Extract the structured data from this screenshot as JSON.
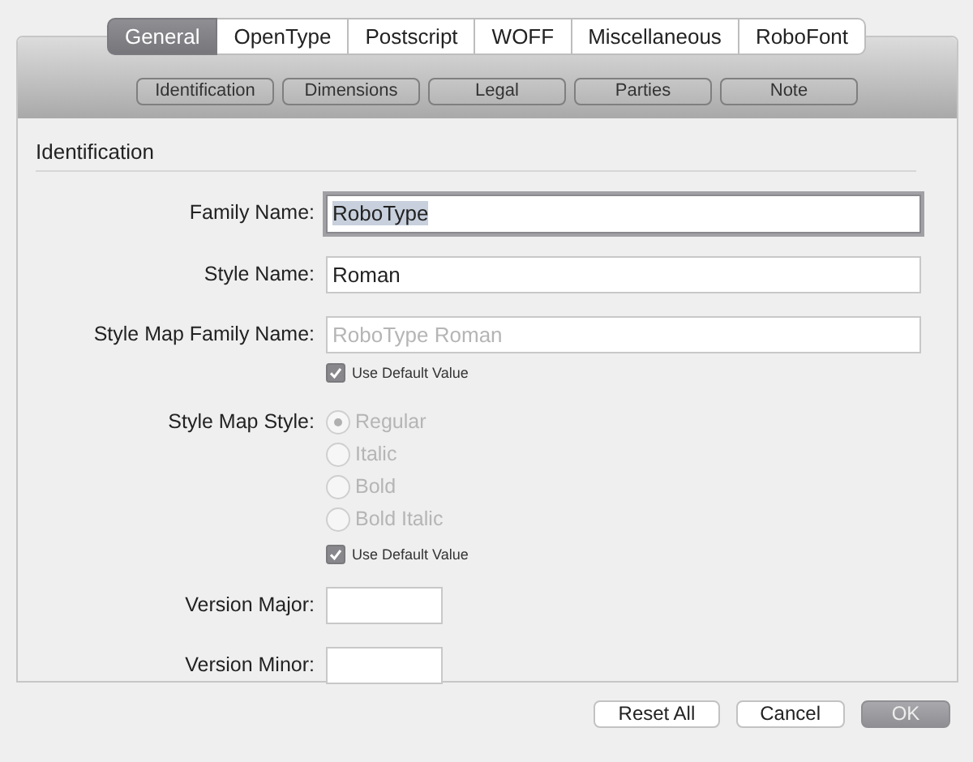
{
  "tabs": [
    {
      "label": "General",
      "selected": true
    },
    {
      "label": "OpenType",
      "selected": false
    },
    {
      "label": "Postscript",
      "selected": false
    },
    {
      "label": "WOFF",
      "selected": false
    },
    {
      "label": "Miscellaneous",
      "selected": false
    },
    {
      "label": "RoboFont",
      "selected": false
    }
  ],
  "subtabs": [
    "Identification",
    "Dimensions",
    "Legal",
    "Parties",
    "Note"
  ],
  "section_title": "Identification",
  "rows": [
    {
      "kind": "text",
      "label": "Family Name:",
      "value": "RoboType",
      "focused": true
    },
    {
      "kind": "text",
      "label": "Style Name:",
      "value": "Roman",
      "focused": false
    },
    {
      "kind": "text",
      "label": "Style Map Family Name:",
      "placeholder": "RoboType Roman",
      "focused": false,
      "default_checkbox": {
        "label": "Use Default Value",
        "checked": true
      }
    },
    {
      "kind": "radio",
      "label": "Style Map Style:",
      "disabled": true,
      "options": [
        {
          "label": "Regular",
          "selected": true
        },
        {
          "label": "Italic",
          "selected": false
        },
        {
          "label": "Bold",
          "selected": false
        },
        {
          "label": "Bold Italic",
          "selected": false
        }
      ],
      "default_checkbox": {
        "label": "Use Default Value",
        "checked": true
      }
    },
    {
      "kind": "short",
      "label": "Version Major:"
    },
    {
      "kind": "short",
      "label": "Version Minor:"
    }
  ],
  "buttons": [
    {
      "label": "Reset All",
      "kind": "normal"
    },
    {
      "label": "Cancel",
      "kind": "normal"
    },
    {
      "label": "OK",
      "kind": "default"
    }
  ]
}
